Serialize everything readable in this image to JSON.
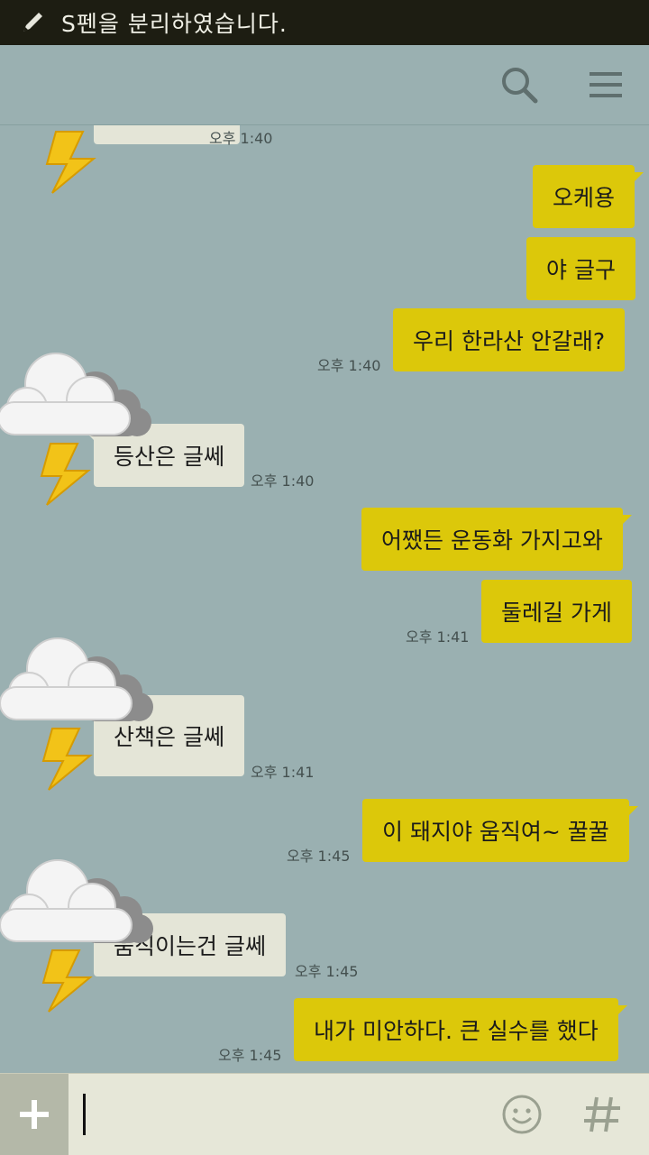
{
  "status_bar": {
    "message": "S펜을 분리하였습니다."
  },
  "messages": [
    {
      "text": "오케용",
      "time": ""
    },
    {
      "text": "야 글구",
      "time": ""
    },
    {
      "text": "우리 한라산 안갈래?",
      "time": "오후 1:40"
    },
    {
      "text": "등산은 글쎄",
      "time": "오후 1:40"
    },
    {
      "text": "어쨌든 운동화 가지고와",
      "time": ""
    },
    {
      "text": "둘레길 가게",
      "time": "오후 1:41"
    },
    {
      "text": "산책은 글쎄",
      "time": "오후 1:41"
    },
    {
      "text": "이 돼지야 움직여~ 꿀꿀",
      "time": "오후 1:45"
    },
    {
      "text": "움직이는건 글쎄",
      "time": "오후 1:45"
    },
    {
      "text": "내가 미안하다. 큰 실수를 했다",
      "time": "오후 1:45"
    }
  ],
  "top_partial": {
    "time": "오후 1:40"
  },
  "colors": {
    "mine": "#dcc80a",
    "theirs": "#e4e5d7",
    "background": "#9ab0b1"
  },
  "icons": [
    "pen-icon",
    "search-icon",
    "menu-icon",
    "storm-cloud-sticker",
    "plus-icon",
    "emoji-icon",
    "hash-icon"
  ]
}
